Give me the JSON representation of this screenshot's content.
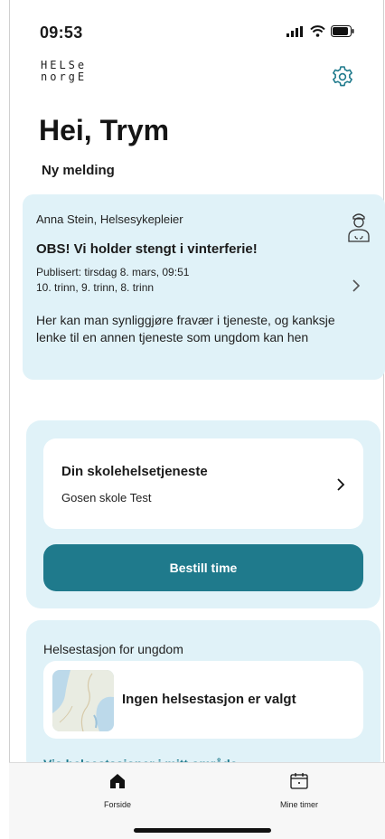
{
  "status_bar": {
    "time": "09:53"
  },
  "app": {
    "logo_line1": "HELSe",
    "logo_line2": "norgE"
  },
  "header": {
    "greeting": "Hei, Trym",
    "subtitle": "Ny melding"
  },
  "message": {
    "sender": "Anna Stein, Helsesykepleier",
    "title": "OBS! Vi holder stengt i vinterferie!",
    "published": "Publisert: tirsdag 8. mars, 09:51",
    "grades": "10. trinn, 9. trinn, 8. trinn",
    "body": "Her kan man synliggjøre fravær i tjeneste, og kanksje lenke til en annen tjeneste som ungdom kan hen"
  },
  "school_service": {
    "title": "Din skolehelsetjeneste",
    "school": "Gosen skole Test",
    "book_button": "Bestill time"
  },
  "health_station": {
    "label": "Helsestasjon for ungdom",
    "none_selected": "Ingen helsestasjon er valgt",
    "link": "Vis helsestasjoner i mitt område"
  },
  "tabs": [
    {
      "label": "Forside",
      "icon": "home-icon"
    },
    {
      "label": "Mine timer",
      "icon": "calendar-icon"
    }
  ],
  "colors": {
    "card_bg": "#e0f2f8",
    "accent": "#1f7a8c"
  }
}
